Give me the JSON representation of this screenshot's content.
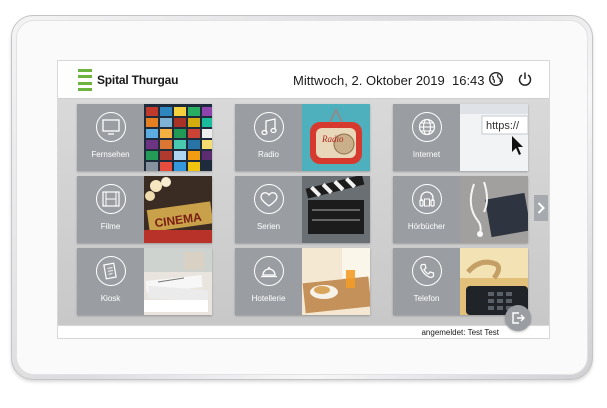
{
  "header": {
    "brand": "Spital Thurgau",
    "datetime": "Mittwoch, 2. Oktober 2019",
    "time": "16:43",
    "globe_icon": "globe-icon",
    "power_icon": "power-icon",
    "brand_color": "#6bb43f"
  },
  "tiles": [
    {
      "label": "Fernsehen",
      "icon": "tv-icon"
    },
    {
      "label": "Radio",
      "icon": "music-note-icon"
    },
    {
      "label": "Internet",
      "icon": "globe-icon"
    },
    {
      "label": "Filme",
      "icon": "film-icon"
    },
    {
      "label": "Serien",
      "icon": "heart-icon"
    },
    {
      "label": "Hörbücher",
      "icon": "headphones-icon"
    },
    {
      "label": "Kiosk",
      "icon": "newspaper-icon"
    },
    {
      "label": "Hotellerie",
      "icon": "cloche-icon"
    },
    {
      "label": "Telefon",
      "icon": "phone-icon"
    }
  ],
  "images": {
    "internet_url": "https://",
    "radio_text": "Radio",
    "cinema_text": "CINEMA"
  },
  "footer": {
    "logged_in": "angemeldet: Test Test"
  },
  "colors": {
    "tile_gray": "#9a9ea3",
    "background": "#d0d0d0"
  }
}
